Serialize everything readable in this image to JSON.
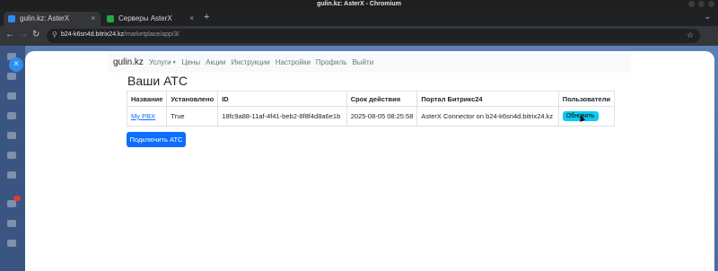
{
  "window": {
    "title": "gulin.kz: AsterX - Chromium"
  },
  "tabs": [
    {
      "label": "gulin.kz: AsterX",
      "close": "×"
    },
    {
      "label": "Серверы AsterX",
      "close": "×"
    }
  ],
  "toolbar": {
    "new_tab": "+",
    "url_host": "b24-k6sn4d.bitrix24.kz",
    "url_path": "/marketplace/app/3/"
  },
  "bitrix": {
    "close_slider": "×"
  },
  "app": {
    "brand": "gulin.kz",
    "nav": {
      "services": "Услуги",
      "prices": "Цены",
      "promos": "Акции",
      "instructions": "Инструкции",
      "settings": "Настройки",
      "profile": "Профиль",
      "logout": "Выйти"
    },
    "page_title": "Ваши АТС",
    "table": {
      "headers": [
        "Название",
        "Установлено",
        "ID",
        "Срок действия",
        "Портал Битрикс24",
        "Пользователи"
      ],
      "rows": [
        {
          "name": "My PBX",
          "installed": "True",
          "id": "18fc9a88-11af-4f41-beb2-8f8f4d8a6e1b",
          "expires": "2025-08-05 08:25:58",
          "portal": "AsterX Connector on b24-k6sn4d.bitrix24.kz",
          "users_button": "Обновить"
        }
      ]
    },
    "connect_button": "Подключить АТС"
  }
}
